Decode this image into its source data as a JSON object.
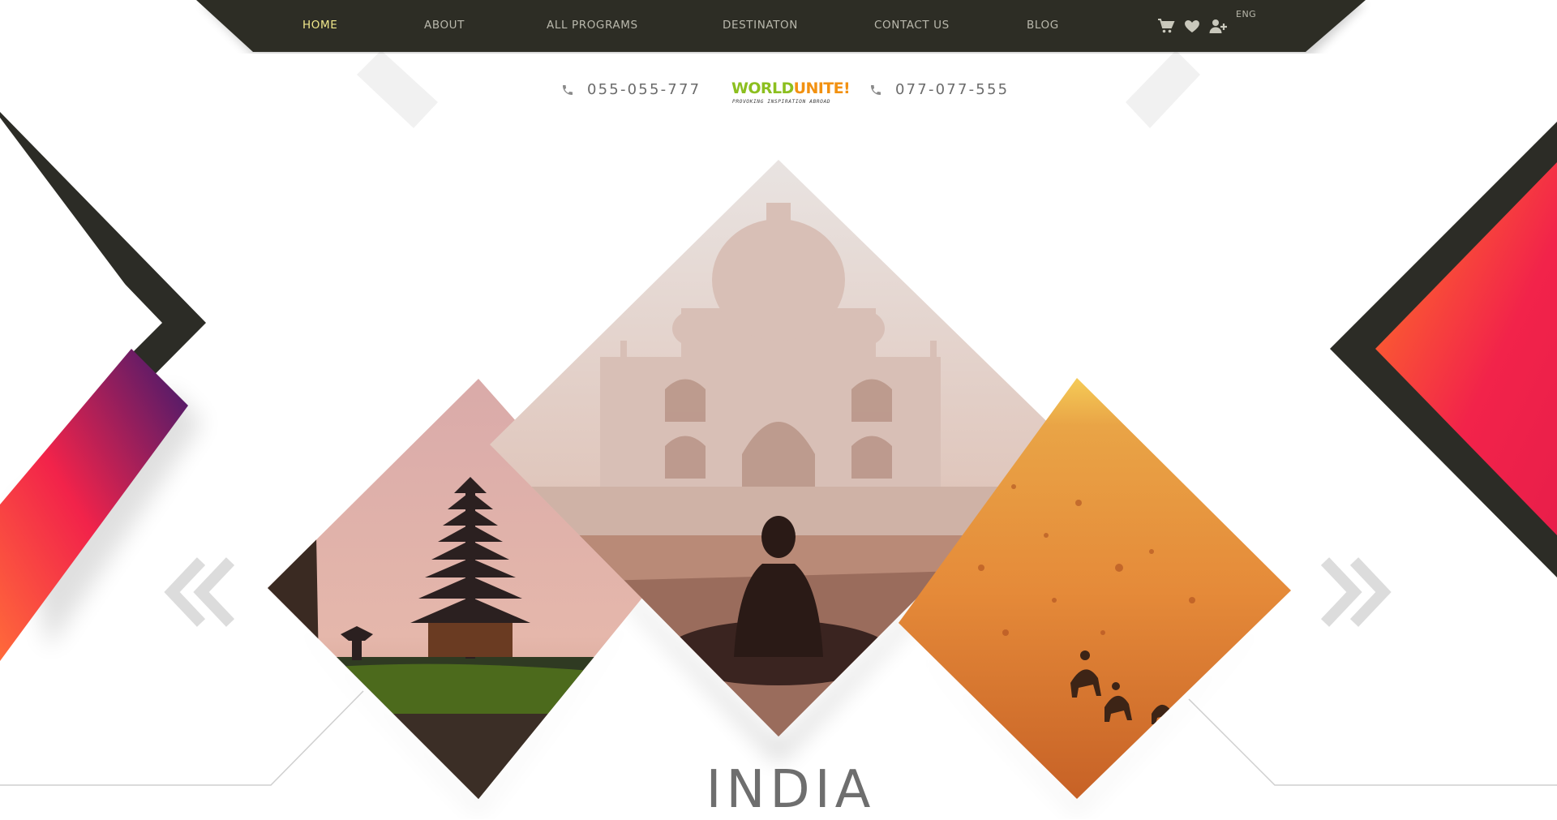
{
  "nav": {
    "items": [
      {
        "label": "HOME",
        "active": true
      },
      {
        "label": "ABOUT",
        "active": false
      },
      {
        "label": "ALL PROGRAMS",
        "active": false
      },
      {
        "label": "DESTINATON",
        "active": false
      },
      {
        "label": "CONTACT US",
        "active": false
      },
      {
        "label": "BLOG",
        "active": false
      }
    ],
    "icons": [
      "cart-icon",
      "heart-icon",
      "add-user-icon"
    ],
    "language": "ENG"
  },
  "contact": {
    "phone_left": "055-055-777",
    "phone_right": "077-077-555"
  },
  "brand": {
    "name_part1": "WORLD",
    "name_part2": "UNITE!",
    "tagline": "PROVOKING INSPIRATION ABROAD"
  },
  "slider": {
    "destination": "INDIA",
    "prev_icon": "double-chevron-left-icon",
    "next_icon": "double-chevron-right-icon",
    "slides": [
      "temple-pagoda-photo",
      "taj-mahal-photo",
      "desert-camels-photo"
    ]
  },
  "colors": {
    "nav_bg": "#2d2d25",
    "nav_active": "#f2e98b",
    "nav_text": "#b9b8ac",
    "dark_chevron": "#2c2c26",
    "gradient_orange": "#ff7a24",
    "gradient_red": "#f2234a",
    "gradient_purple": "#3b1a6e",
    "logo_green": "#8cbf1f",
    "logo_orange": "#f29111"
  }
}
